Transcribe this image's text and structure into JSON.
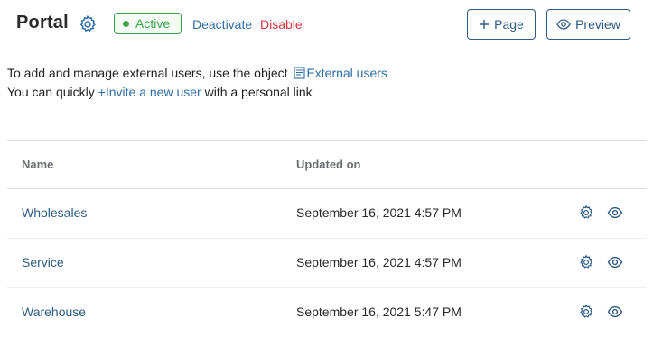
{
  "header": {
    "title": "Portal",
    "status_label": "Active",
    "deactivate_label": "Deactivate",
    "disable_label": "Disable",
    "add_page_label": "Page",
    "preview_label": "Preview"
  },
  "info": {
    "line1_prefix": "To add and manage external users, use the object",
    "line1_link": "External users",
    "line2_prefix": "You can quickly",
    "line2_link": "Invite a new user",
    "line2_suffix": "with a personal link"
  },
  "table": {
    "columns": {
      "name": "Name",
      "updated": "Updated on"
    },
    "rows": [
      {
        "name": "Wholesales",
        "updated": "September 16, 2021 4:57 PM"
      },
      {
        "name": "Service",
        "updated": "September 16, 2021 4:57 PM"
      },
      {
        "name": "Warehouse",
        "updated": "September 16, 2021 5:47 PM"
      }
    ]
  },
  "colors": {
    "accent": "#2d5b84",
    "link": "#2d6ca2",
    "active_green": "#3fa34d",
    "danger": "#d6313d"
  },
  "icons": [
    "gear-icon",
    "plus-icon",
    "eye-icon",
    "document-icon"
  ]
}
